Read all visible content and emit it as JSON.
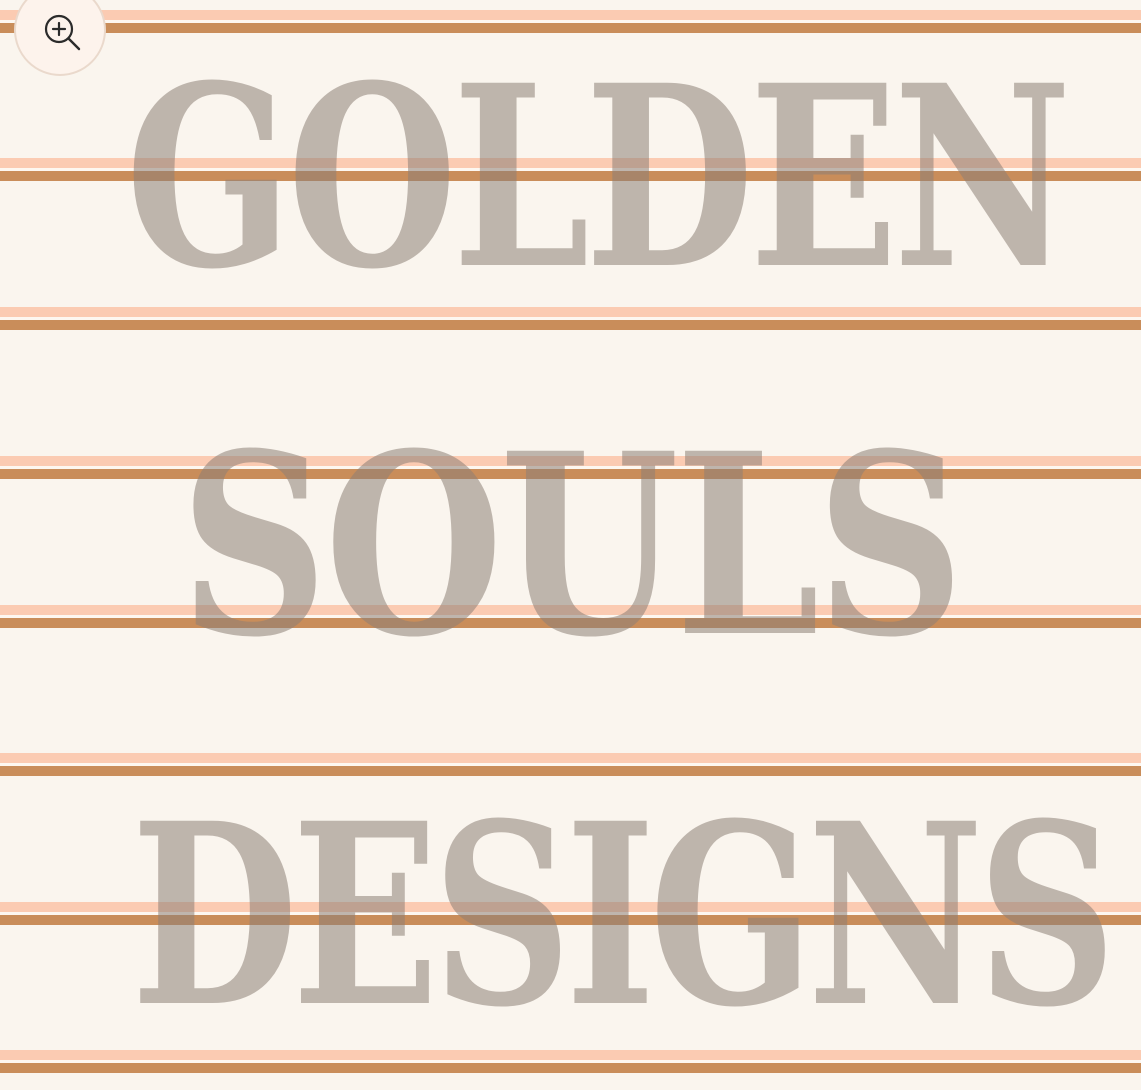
{
  "watermark": {
    "line1": "GOLDEN",
    "line2": "SOULS",
    "line3": "DESIGNS"
  },
  "zoom_button": {
    "icon": "zoom-in-icon"
  },
  "colors": {
    "background": "#faf5ee",
    "stripe_pink": "#fbcbb2",
    "stripe_brown": "#c98d5a",
    "watermark": "#8c8076"
  }
}
